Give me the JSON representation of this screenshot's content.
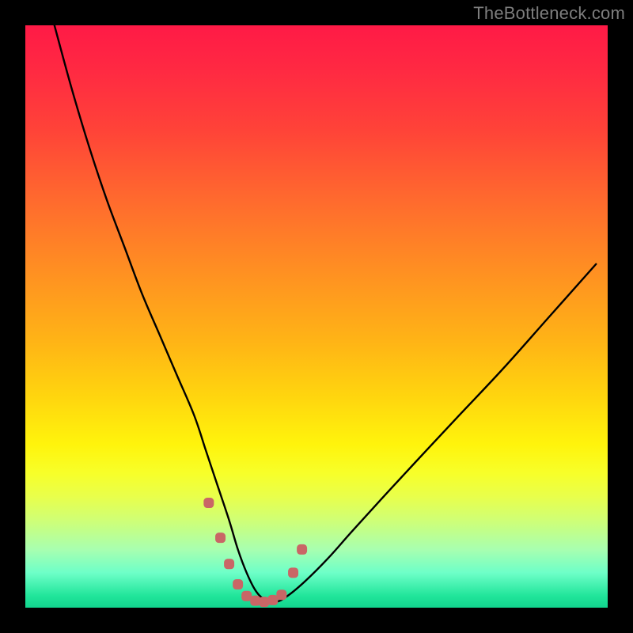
{
  "watermark": "TheBottleneck.com",
  "colors": {
    "frame": "#000000",
    "curve": "#000000",
    "marker": "#c96666",
    "gradient_top": "#ff1a46",
    "gradient_bottom": "#12d48e"
  },
  "chart_data": {
    "type": "line",
    "title": "",
    "xlabel": "",
    "ylabel": "",
    "xlim": [
      0,
      100
    ],
    "ylim": [
      0,
      100
    ],
    "grid": false,
    "series": [
      {
        "name": "bottleneck-curve",
        "x": [
          5,
          8,
          11,
          14,
          17,
          20,
          23,
          26,
          29,
          31,
          33,
          35,
          36.5,
          38,
          39.5,
          41,
          43,
          45,
          48,
          52,
          56,
          61,
          67,
          74,
          82,
          90,
          98
        ],
        "values": [
          100,
          89,
          79,
          70,
          62,
          54,
          47,
          40,
          33,
          27,
          21,
          15,
          10,
          6,
          3,
          1.5,
          1,
          2,
          4.5,
          8.5,
          13,
          18.5,
          25,
          32.5,
          41,
          50,
          59
        ]
      }
    ],
    "markers": {
      "name": "trough-markers",
      "x": [
        31.5,
        33.5,
        35,
        36.5,
        38,
        39.5,
        41,
        42.5,
        44,
        46,
        47.5
      ],
      "values": [
        18,
        12,
        7.5,
        4,
        2,
        1.2,
        1,
        1.3,
        2.2,
        6,
        10
      ]
    }
  }
}
